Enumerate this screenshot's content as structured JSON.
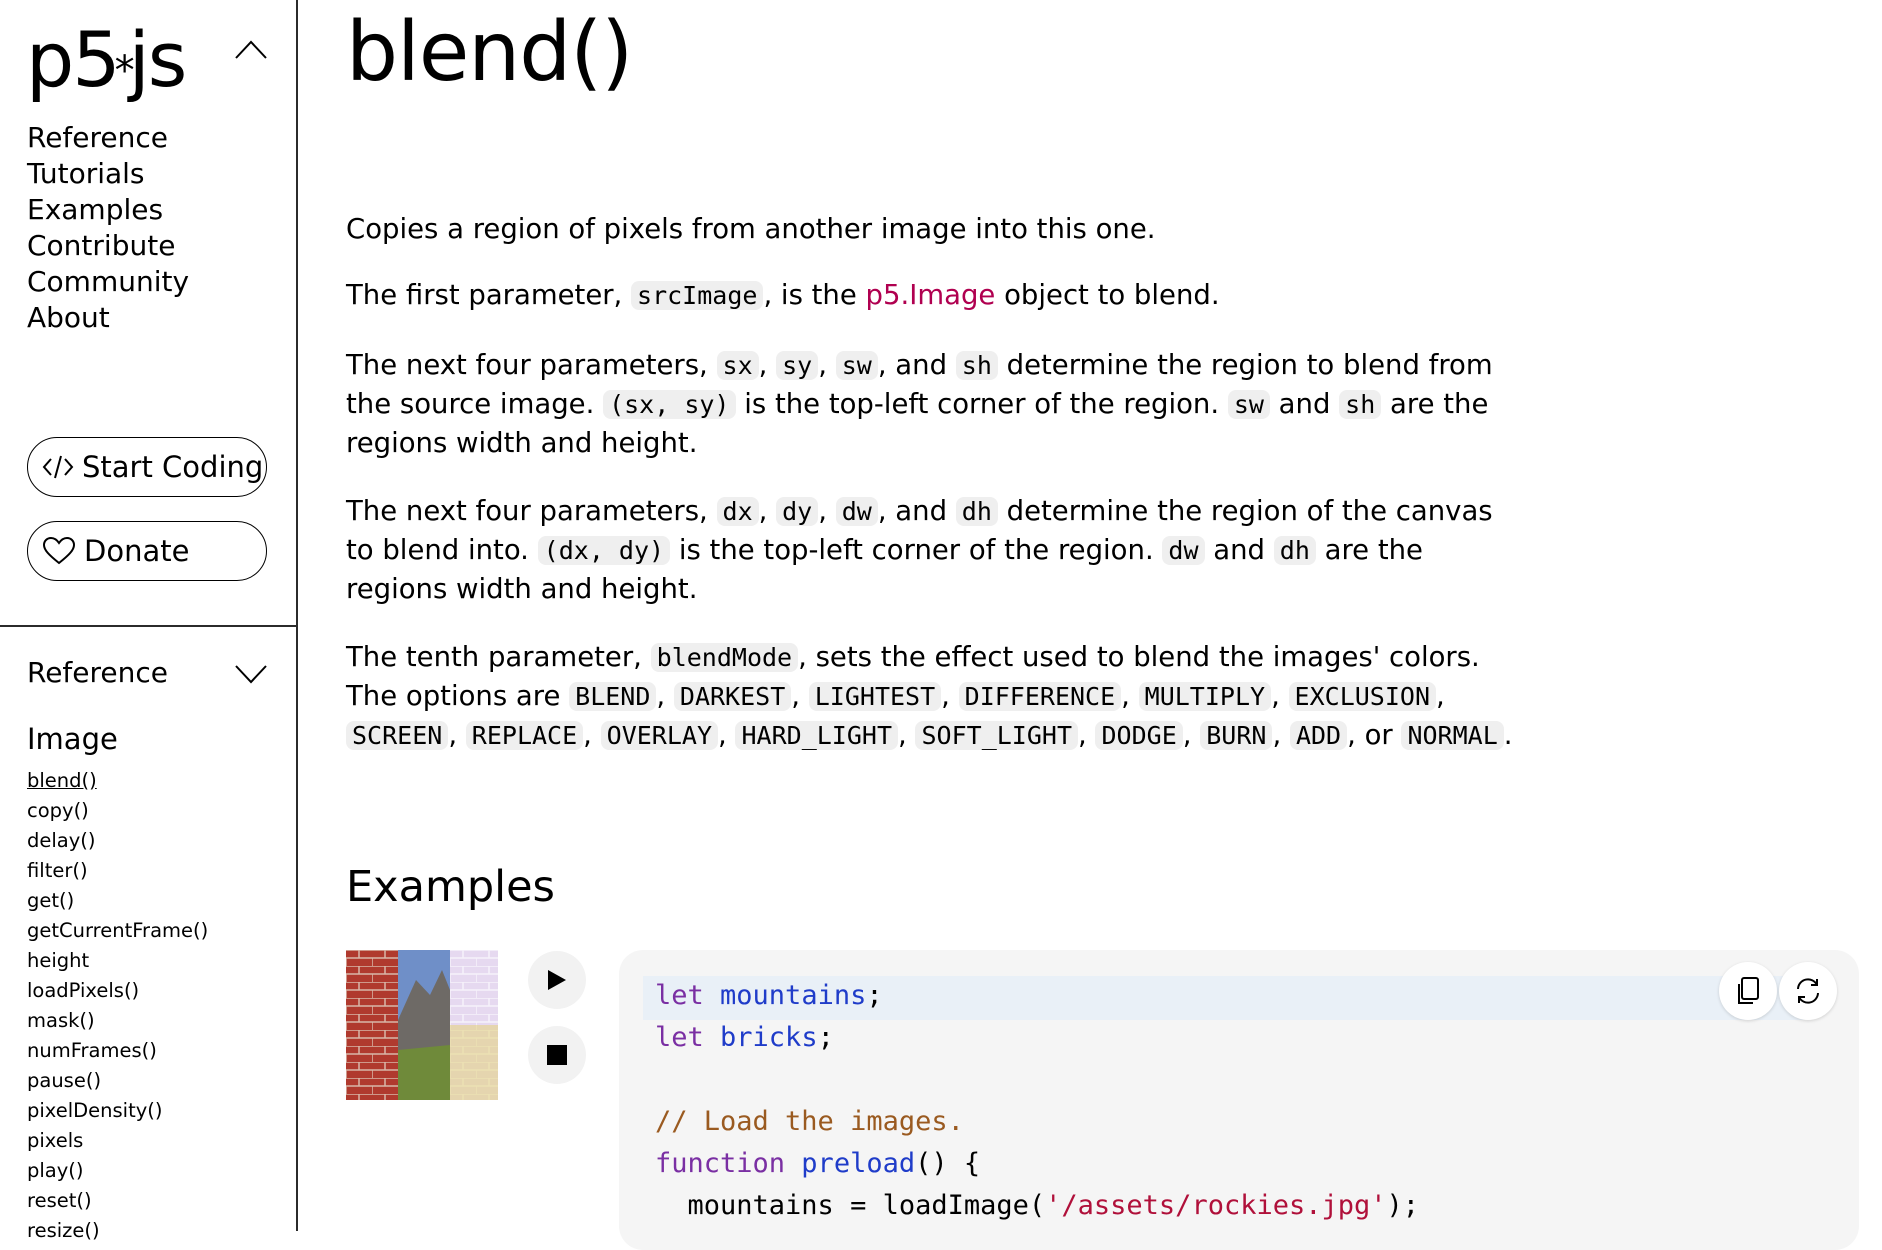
{
  "sidebar": {
    "logo_text": "p5",
    "logo_star": "*",
    "logo_js": "js",
    "nav": [
      "Reference",
      "Tutorials",
      "Examples",
      "Contribute",
      "Community",
      "About"
    ],
    "start_coding_label": "Start Coding",
    "donate_label": "Donate",
    "reference_section": {
      "header": "Reference",
      "category": "Image",
      "items": [
        "blend()",
        "copy()",
        "delay()",
        "filter()",
        "get()",
        "getCurrentFrame()",
        "height",
        "loadPixels()",
        "mask()",
        "numFrames()",
        "pause()",
        "pixelDensity()",
        "pixels",
        "play()",
        "reset()",
        "resize()"
      ],
      "active_item": "blend()"
    }
  },
  "main": {
    "title": "blend()",
    "description": {
      "p1": "Copies a region of pixels from another image into this one.",
      "p2": {
        "a": "The first parameter, ",
        "code1": "srcImage",
        "b": ", is the ",
        "link": "p5.Image",
        "c": " object to blend."
      },
      "p3": {
        "a": "The next four parameters, ",
        "c1": "sx",
        "s1": ", ",
        "c2": "sy",
        "s2": ", ",
        "c3": "sw",
        "s3": ", and ",
        "c4": "sh",
        "s4": " determine the region to blend from the source image. ",
        "c5": "(sx, sy)",
        "s5": " is the top-left corner of the region. ",
        "c6": "sw",
        "s6": " and ",
        "c7": "sh",
        "s7": " are the regions width and height."
      },
      "p4": {
        "a": "The next four parameters, ",
        "c1": "dx",
        "s1": ", ",
        "c2": "dy",
        "s2": ", ",
        "c3": "dw",
        "s3": ", and ",
        "c4": "dh",
        "s4": " determine the region of the canvas to blend into. ",
        "c5": "(dx, dy)",
        "s5": " is the top-left corner of the region. ",
        "c6": "dw",
        "s6": " and ",
        "c7": "dh",
        "s7": " are the regions width and height."
      },
      "p5": {
        "a": "The tenth parameter, ",
        "c0": "blendMode",
        "b": ", sets the effect used to blend the images' colors. The options are ",
        "modes": [
          "BLEND",
          "DARKEST",
          "LIGHTEST",
          "DIFFERENCE",
          "MULTIPLY",
          "EXCLUSION",
          "SCREEN",
          "REPLACE",
          "OVERLAY",
          "HARD_LIGHT",
          "SOFT_LIGHT",
          "DODGE",
          "BURN",
          "ADD"
        ],
        "or": ", or ",
        "last": "NORMAL",
        "end": "."
      }
    },
    "examples_heading": "Examples",
    "code_lines": {
      "l1_kw": "let",
      "l1_rest": " mountains",
      "l1_end": ";",
      "l2_kw": "let",
      "l2_rest": " bricks",
      "l2_end": ";",
      "l4": "// Load the images.",
      "l5_kw": "function",
      "l5_fn": " preload",
      "l5_end": "() {",
      "l6_a": "  mountains = loadImage(",
      "l6_str": "'/assets/rockies.jpg'",
      "l6_end": ");"
    }
  },
  "icons": {
    "collapse": "chevron-up-icon",
    "expand": "chevron-down-icon",
    "code": "code-icon",
    "heart": "heart-icon",
    "play": "play-icon",
    "stop": "stop-icon",
    "copy": "copy-icon",
    "reset": "reset-icon"
  },
  "colors": {
    "link": "#b00050",
    "keyword": "#7a2fa3",
    "function": "#1f3cc9",
    "comment": "#9a5a20",
    "string": "#b0103a"
  }
}
